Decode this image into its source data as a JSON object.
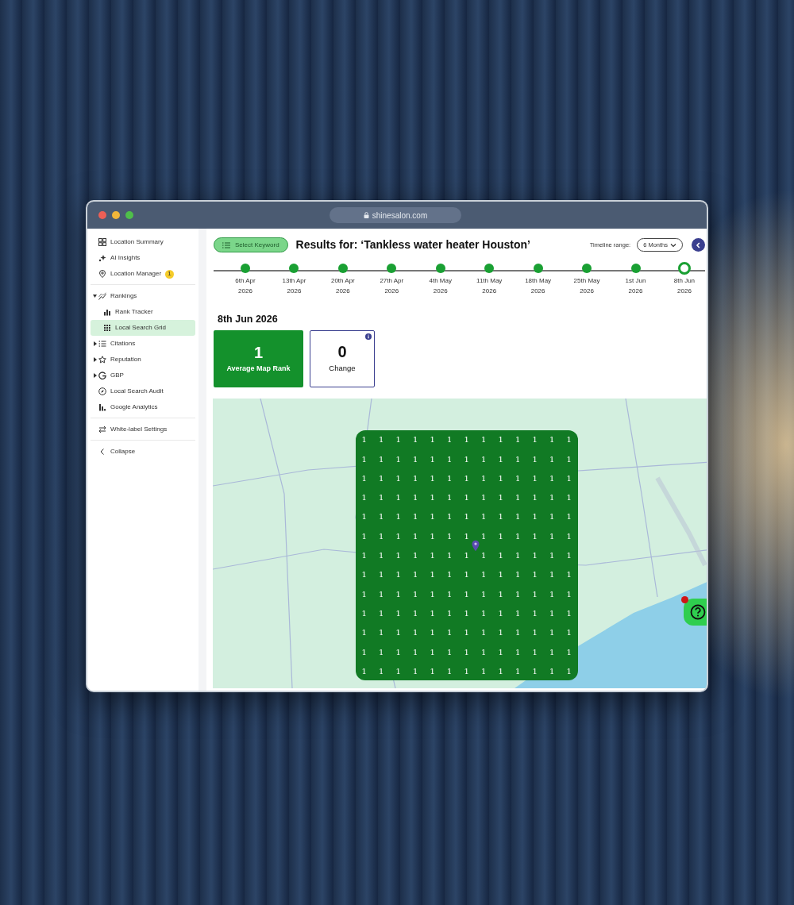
{
  "browser": {
    "url": "shinesalon.com"
  },
  "sidebar": {
    "sections": [
      {
        "items": [
          {
            "kind": "link",
            "label": "Location Summary",
            "selected": false
          },
          {
            "kind": "link",
            "label": "AI Insights",
            "selected": false
          },
          {
            "kind": "link",
            "label": "Location Manager",
            "selected": false,
            "badge": "1"
          }
        ]
      },
      {
        "items": [
          {
            "kind": "group",
            "label": "Rankings",
            "selected": false,
            "expanded": true,
            "children": [
              {
                "kind": "link",
                "label": "Rank Tracker",
                "selected": false
              },
              {
                "kind": "link",
                "label": "Local Search Grid",
                "selected": true
              }
            ]
          },
          {
            "kind": "group",
            "label": "Citations",
            "selected": false,
            "expanded": false
          },
          {
            "kind": "group",
            "label": "Reputation",
            "selected": false,
            "expanded": false
          },
          {
            "kind": "group",
            "label": "GBP",
            "selected": false,
            "expanded": false
          },
          {
            "kind": "link",
            "label": "Local Search Audit",
            "selected": false
          },
          {
            "kind": "link",
            "label": "Google Analytics",
            "selected": false
          }
        ]
      },
      {
        "items": [
          {
            "kind": "link",
            "label": "White-label Settings",
            "selected": false
          }
        ]
      },
      {
        "items": [
          {
            "kind": "link",
            "label": "Collapse",
            "selected": false
          }
        ]
      }
    ]
  },
  "header": {
    "keyword_button": "Select Keyword",
    "title": "Results for: ‘Tankless water heater Houston’",
    "timeline_range_label": "Timeline range:",
    "timeline_range": "6 Months"
  },
  "timeline": [
    {
      "date": "6th Apr",
      "year": "2026",
      "selected": false
    },
    {
      "date": "13th Apr",
      "year": "2026",
      "selected": false
    },
    {
      "date": "20th Apr",
      "year": "2026",
      "selected": false
    },
    {
      "date": "27th Apr",
      "year": "2026",
      "selected": false
    },
    {
      "date": "4th May",
      "year": "2026",
      "selected": false
    },
    {
      "date": "11th May",
      "year": "2026",
      "selected": false
    },
    {
      "date": "18th May",
      "year": "2026",
      "selected": false
    },
    {
      "date": "25th May",
      "year": "2026",
      "selected": false
    },
    {
      "date": "1st Jun",
      "year": "2026",
      "selected": false
    },
    {
      "date": "8th Jun",
      "year": "2026",
      "selected": true
    }
  ],
  "selected_date": "8th Jun 2026",
  "stats": [
    {
      "kind": "filled",
      "value": "1",
      "label": "Average Map Rank"
    },
    {
      "kind": "outlined",
      "value": "0",
      "label": "Change",
      "info": true
    }
  ],
  "grid": {
    "rows": [
      [
        "1",
        "1",
        "1",
        "1",
        "1",
        "1",
        "1",
        "1",
        "1",
        "1",
        "1",
        "1",
        "1"
      ],
      [
        "1",
        "1",
        "1",
        "1",
        "1",
        "1",
        "1",
        "1",
        "1",
        "1",
        "1",
        "1",
        "1"
      ],
      [
        "1",
        "1",
        "1",
        "1",
        "1",
        "1",
        "1",
        "1",
        "1",
        "1",
        "1",
        "1",
        "1"
      ],
      [
        "1",
        "1",
        "1",
        "1",
        "1",
        "1",
        "1",
        "1",
        "1",
        "1",
        "1",
        "1",
        "1"
      ],
      [
        "1",
        "1",
        "1",
        "1",
        "1",
        "1",
        "1",
        "1",
        "1",
        "1",
        "1",
        "1",
        "1"
      ],
      [
        "1",
        "1",
        "1",
        "1",
        "1",
        "1",
        "1",
        "1",
        "1",
        "1",
        "1",
        "1",
        "1"
      ],
      [
        "1",
        "1",
        "1",
        "1",
        "1",
        "1",
        "1",
        "1",
        "1",
        "1",
        "1",
        "1",
        "1"
      ],
      [
        "1",
        "1",
        "1",
        "1",
        "1",
        "1",
        "1",
        "1",
        "1",
        "1",
        "1",
        "1",
        "1"
      ],
      [
        "1",
        "1",
        "1",
        "1",
        "1",
        "1",
        "1",
        "1",
        "1",
        "1",
        "1",
        "1",
        "1"
      ],
      [
        "1",
        "1",
        "1",
        "1",
        "1",
        "1",
        "1",
        "1",
        "1",
        "1",
        "1",
        "1",
        "1"
      ],
      [
        "1",
        "1",
        "1",
        "1",
        "1",
        "1",
        "1",
        "1",
        "1",
        "1",
        "1",
        "1",
        "1"
      ],
      [
        "1",
        "1",
        "1",
        "1",
        "1",
        "1",
        "1",
        "1",
        "1",
        "1",
        "1",
        "1",
        "1"
      ],
      [
        "1",
        "1",
        "1",
        "1",
        "1",
        "1",
        "1",
        "1",
        "1",
        "1",
        "1",
        "1",
        "1"
      ]
    ]
  },
  "help": {
    "notification": true
  }
}
